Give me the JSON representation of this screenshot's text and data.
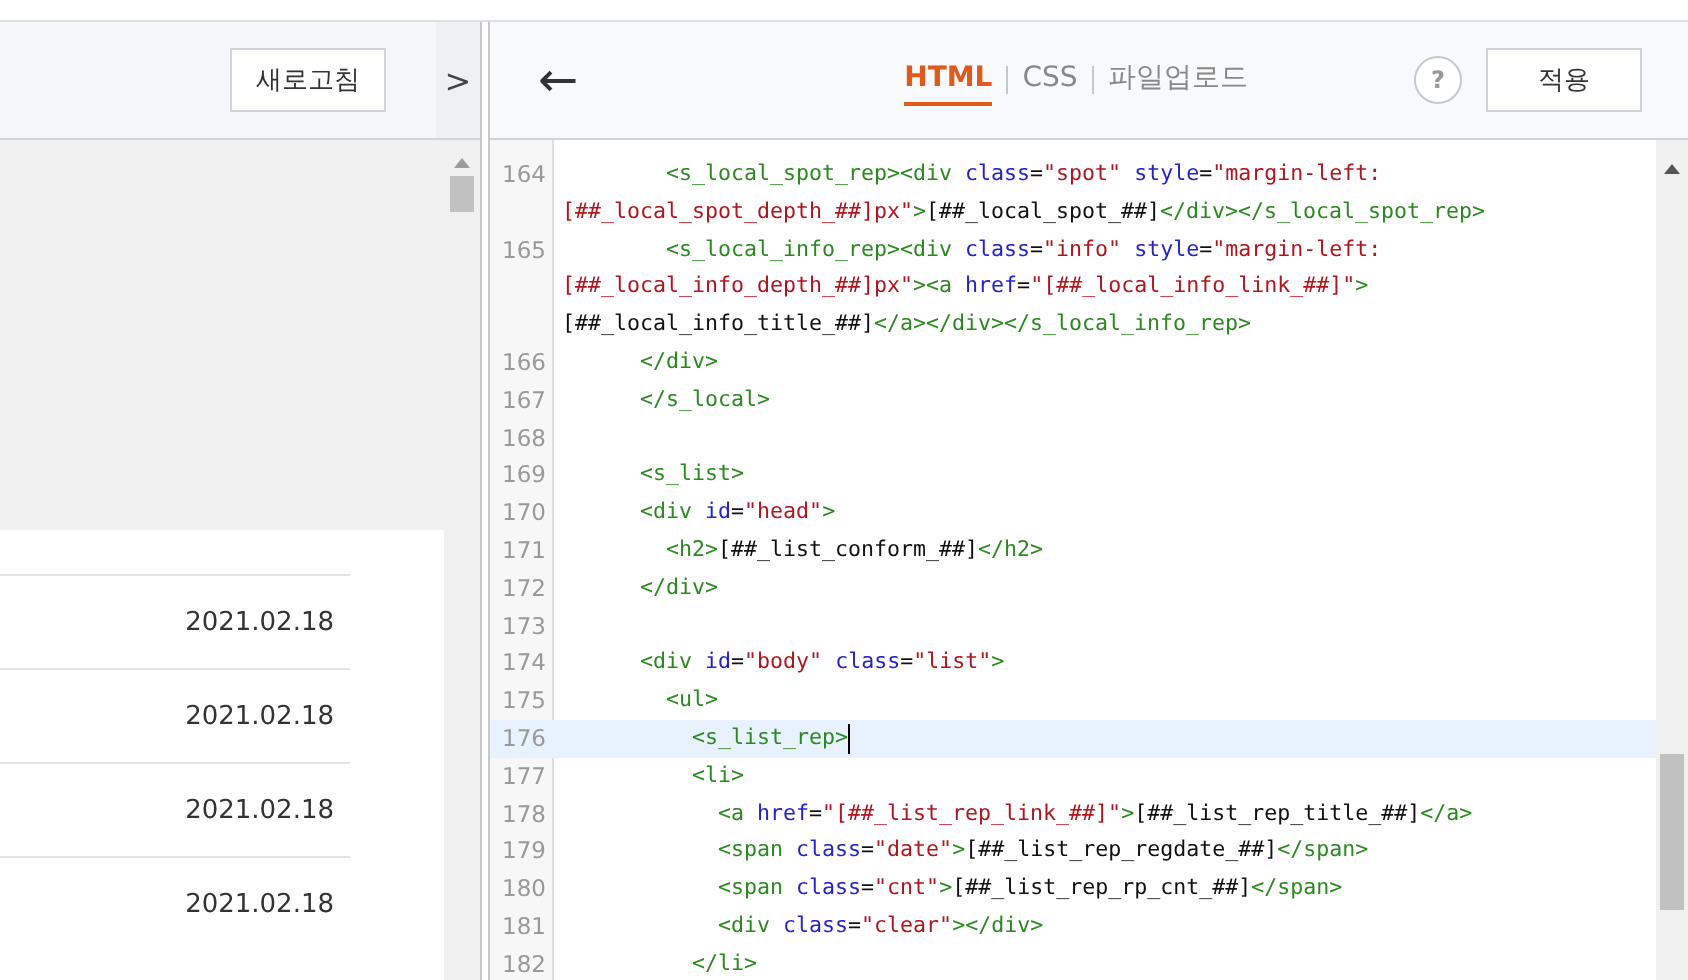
{
  "left_panel": {
    "refresh_button": "새로고침",
    "collapse_toggle": ">",
    "list": [
      {
        "date": "2021.02.18"
      },
      {
        "date": "2021.02.18"
      },
      {
        "date": "2021.02.18"
      },
      {
        "date": "2021.02.18"
      }
    ]
  },
  "editor": {
    "back_label": "←",
    "tabs": [
      {
        "label": "HTML",
        "selected": true
      },
      {
        "label": "CSS",
        "selected": false
      },
      {
        "label": "파일업로드",
        "selected": false
      }
    ],
    "help": "?",
    "apply_button": "적용",
    "lines": [
      {
        "number": "164",
        "active": false,
        "rows": [
          {
            "tokens": [
              {
                "kind": "tag",
                "text": "        <s_local_spot_rep><div "
              },
              {
                "kind": "attr",
                "text": "class"
              },
              {
                "kind": "text",
                "text": "="
              },
              {
                "kind": "value",
                "text": "\"spot\""
              },
              {
                "kind": "attr",
                "text": " style"
              },
              {
                "kind": "text",
                "text": "="
              },
              {
                "kind": "value",
                "text": "\"margin-left:"
              }
            ]
          },
          {
            "tokens": [
              {
                "kind": "value",
                "text": "[##_local_spot_depth_##]px\""
              },
              {
                "kind": "tag",
                "text": ">"
              },
              {
                "kind": "text",
                "text": "[##_local_spot_##]"
              },
              {
                "kind": "tag",
                "text": "</div></s_local_spot_rep>"
              }
            ]
          }
        ]
      },
      {
        "number": "165",
        "active": false,
        "rows": [
          {
            "tokens": [
              {
                "kind": "tag",
                "text": "        <s_local_info_rep><div "
              },
              {
                "kind": "attr",
                "text": "class"
              },
              {
                "kind": "text",
                "text": "="
              },
              {
                "kind": "value",
                "text": "\"info\""
              },
              {
                "kind": "attr",
                "text": " style"
              },
              {
                "kind": "text",
                "text": "="
              },
              {
                "kind": "value",
                "text": "\"margin-left:"
              }
            ]
          },
          {
            "tokens": [
              {
                "kind": "value",
                "text": "[##_local_info_depth_##]px\""
              },
              {
                "kind": "tag",
                "text": "><a "
              },
              {
                "kind": "attr",
                "text": "href"
              },
              {
                "kind": "text",
                "text": "="
              },
              {
                "kind": "value",
                "text": "\"[##_local_info_link_##]\""
              },
              {
                "kind": "tag",
                "text": ">"
              }
            ]
          },
          {
            "tokens": [
              {
                "kind": "text",
                "text": "[##_local_info_title_##]"
              },
              {
                "kind": "tag",
                "text": "</a></div></s_local_info_rep>"
              }
            ]
          }
        ]
      },
      {
        "number": "166",
        "active": false,
        "rows": [
          {
            "tokens": [
              {
                "kind": "tag",
                "text": "      </div>"
              }
            ]
          }
        ]
      },
      {
        "number": "167",
        "active": false,
        "rows": [
          {
            "tokens": [
              {
                "kind": "tag",
                "text": "      </s_local>"
              }
            ]
          }
        ]
      },
      {
        "number": "168",
        "active": false
      },
      {
        "number": "169",
        "active": false,
        "rows": [
          {
            "tokens": [
              {
                "kind": "tag",
                "text": "      <s_list>"
              }
            ]
          }
        ]
      },
      {
        "number": "170",
        "active": false,
        "rows": [
          {
            "tokens": [
              {
                "kind": "tag",
                "text": "      <div "
              },
              {
                "kind": "attr",
                "text": "id"
              },
              {
                "kind": "text",
                "text": "="
              },
              {
                "kind": "value",
                "text": "\"head\""
              },
              {
                "kind": "tag",
                "text": ">"
              }
            ]
          }
        ]
      },
      {
        "number": "171",
        "active": false,
        "rows": [
          {
            "tokens": [
              {
                "kind": "tag",
                "text": "        <h2>"
              },
              {
                "kind": "text",
                "text": "[##_list_conform_##]"
              },
              {
                "kind": "tag",
                "text": "</h2>"
              }
            ]
          }
        ]
      },
      {
        "number": "172",
        "active": false,
        "rows": [
          {
            "tokens": [
              {
                "kind": "tag",
                "text": "      </div>"
              }
            ]
          }
        ]
      },
      {
        "number": "173",
        "active": false
      },
      {
        "number": "174",
        "active": false,
        "rows": [
          {
            "tokens": [
              {
                "kind": "tag",
                "text": "      <div "
              },
              {
                "kind": "attr",
                "text": "id"
              },
              {
                "kind": "text",
                "text": "="
              },
              {
                "kind": "value",
                "text": "\"body\""
              },
              {
                "kind": "attr",
                "text": " class"
              },
              {
                "kind": "text",
                "text": "="
              },
              {
                "kind": "value",
                "text": "\"list\""
              },
              {
                "kind": "tag",
                "text": ">"
              }
            ]
          }
        ]
      },
      {
        "number": "175",
        "active": false,
        "rows": [
          {
            "tokens": [
              {
                "kind": "tag",
                "text": "        <ul>"
              }
            ]
          }
        ]
      },
      {
        "number": "176",
        "active": true,
        "rows": [
          {
            "tokens": [
              {
                "kind": "tag",
                "text": "          <s_list_rep>"
              }
            ]
          }
        ]
      },
      {
        "number": "177",
        "active": false,
        "rows": [
          {
            "tokens": [
              {
                "kind": "tag",
                "text": "          <li>"
              }
            ]
          }
        ]
      },
      {
        "number": "178",
        "active": false,
        "rows": [
          {
            "tokens": [
              {
                "kind": "tag",
                "text": "            <a "
              },
              {
                "kind": "attr",
                "text": "href"
              },
              {
                "kind": "text",
                "text": "="
              },
              {
                "kind": "value",
                "text": "\"[##_list_rep_link_##]\""
              },
              {
                "kind": "tag",
                "text": ">"
              },
              {
                "kind": "text",
                "text": "[##_list_rep_title_##]"
              },
              {
                "kind": "tag",
                "text": "</a>"
              }
            ]
          }
        ]
      },
      {
        "number": "179",
        "active": false,
        "rows": [
          {
            "tokens": [
              {
                "kind": "tag",
                "text": "            <span "
              },
              {
                "kind": "attr",
                "text": "class"
              },
              {
                "kind": "text",
                "text": "="
              },
              {
                "kind": "value",
                "text": "\"date\""
              },
              {
                "kind": "tag",
                "text": ">"
              },
              {
                "kind": "text",
                "text": "[##_list_rep_regdate_##]"
              },
              {
                "kind": "tag",
                "text": "</span>"
              }
            ]
          }
        ]
      },
      {
        "number": "180",
        "active": false,
        "rows": [
          {
            "tokens": [
              {
                "kind": "tag",
                "text": "            <span "
              },
              {
                "kind": "attr",
                "text": "class"
              },
              {
                "kind": "text",
                "text": "="
              },
              {
                "kind": "value",
                "text": "\"cnt\""
              },
              {
                "kind": "tag",
                "text": ">"
              },
              {
                "kind": "text",
                "text": "[##_list_rep_rp_cnt_##]"
              },
              {
                "kind": "tag",
                "text": "</span>"
              }
            ]
          }
        ]
      },
      {
        "number": "181",
        "active": false,
        "rows": [
          {
            "tokens": [
              {
                "kind": "tag",
                "text": "            <div "
              },
              {
                "kind": "attr",
                "text": "class"
              },
              {
                "kind": "text",
                "text": "="
              },
              {
                "kind": "value",
                "text": "\"clear\""
              },
              {
                "kind": "tag",
                "text": "></div>"
              }
            ]
          }
        ]
      },
      {
        "number": "182",
        "active": false,
        "rows": [
          {
            "tokens": [
              {
                "kind": "tag",
                "text": "          </li>"
              }
            ]
          }
        ]
      }
    ]
  }
}
